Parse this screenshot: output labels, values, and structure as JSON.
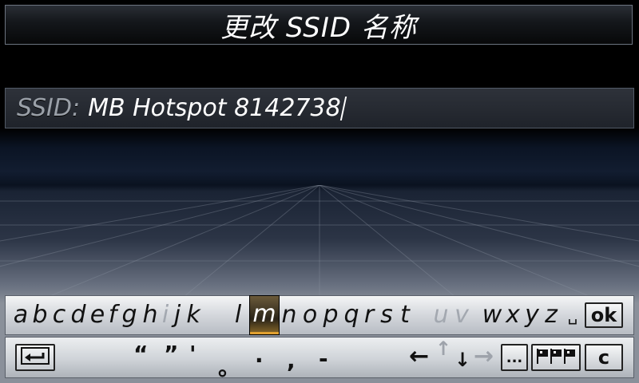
{
  "header": {
    "title": "更改 SSID 名称"
  },
  "field": {
    "label": "SSID:",
    "value": "MB Hotspot 8142738"
  },
  "keyboard": {
    "letters": [
      "a",
      "b",
      "c",
      "d",
      "e",
      "f",
      "g",
      "h",
      "i",
      "j",
      "k",
      "l",
      "m",
      "n",
      "o",
      "p",
      "q",
      "r",
      "s",
      "t",
      "u",
      "v",
      "w",
      "x",
      "y",
      "z"
    ],
    "selected_letter": "m",
    "disabled_letters": [
      "i",
      "u",
      "v"
    ],
    "space_symbol": "␣",
    "ok_label": "ok",
    "symbols": [
      "“",
      "”",
      "'",
      "。",
      "·",
      ",",
      "-"
    ],
    "more_label": "...",
    "clear_label": "c",
    "icons": {
      "back": "return-icon",
      "left": "left-arrow-icon",
      "up": "up-arrow-icon",
      "down": "down-arrow-icon",
      "right": "right-arrow-icon",
      "language": "flags-icon"
    },
    "accent_color": "#e0a030"
  }
}
